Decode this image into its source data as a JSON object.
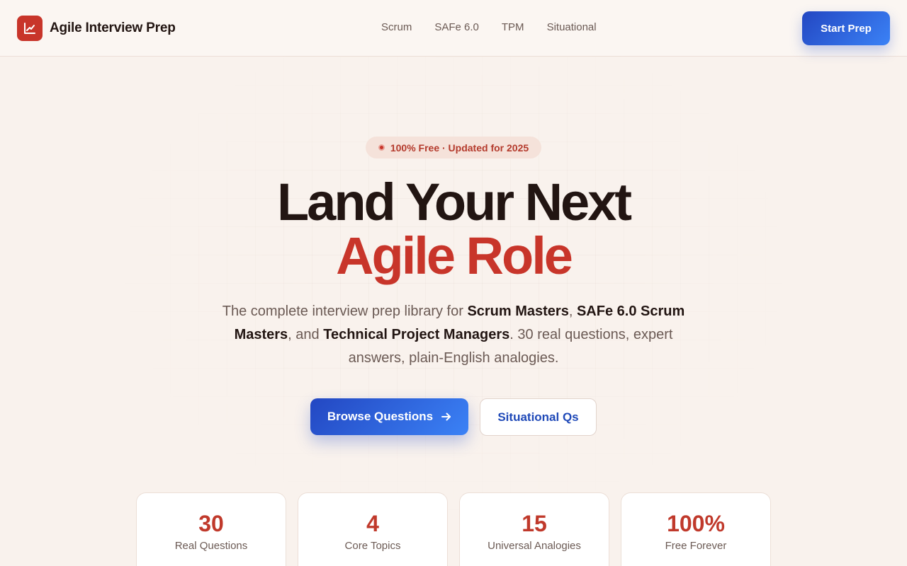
{
  "header": {
    "brand_name": "Agile Interview Prep",
    "brand_icon": "trend-chart-icon",
    "nav": [
      {
        "label": "Scrum"
      },
      {
        "label": "SAFe 6.0"
      },
      {
        "label": "TPM"
      },
      {
        "label": "Situational"
      }
    ],
    "cta_label": "Start Prep"
  },
  "hero": {
    "badge": "100% Free · Updated for 2025",
    "headline_line1": "Land Your Next",
    "headline_line2": "Agile Role",
    "subtitle": {
      "part1": "The complete interview prep library for ",
      "bold1": "Scrum Masters",
      "part2": ", ",
      "bold2": "SAFe 6.0 Scrum Masters",
      "part3": ", and ",
      "bold3": "Technical Project Managers",
      "part4": ". 30 real questions, expert answers, plain-English analogies."
    },
    "primary_button": "Browse Questions",
    "secondary_button": "Situational Qs"
  },
  "stats": [
    {
      "value": "30",
      "label": "Real Questions"
    },
    {
      "value": "4",
      "label": "Core Topics"
    },
    {
      "value": "15",
      "label": "Universal Analogies"
    },
    {
      "value": "100%",
      "label": "Free Forever"
    }
  ],
  "colors": {
    "accent_red": "#c8352a",
    "accent_blue": "#2347c2",
    "background": "#f9f2ed"
  }
}
